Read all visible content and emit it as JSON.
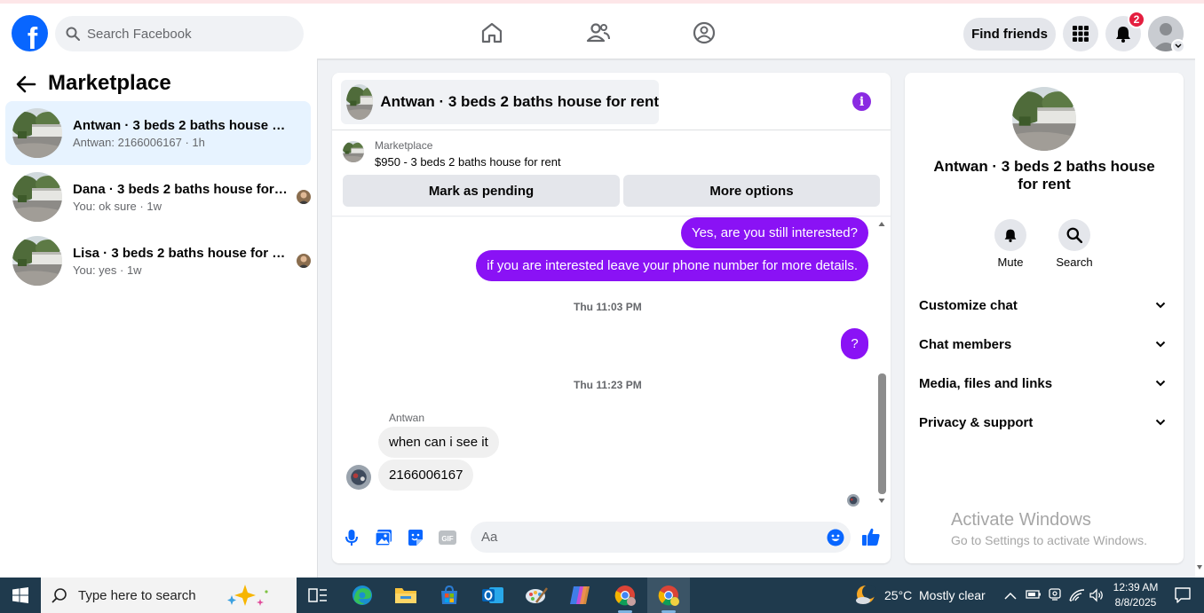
{
  "topbar": {
    "logo_letter": "f",
    "search_placeholder": "Search Facebook",
    "find_friends_label": "Find friends",
    "notification_count": "2"
  },
  "sidebar": {
    "title": "Marketplace",
    "conversations": [
      {
        "title": "Antwan · 3 beds 2 baths house for rent",
        "subtitle": "Antwan: 2166006167 · 1h",
        "active": true
      },
      {
        "title": "Dana · 3 beds 2 baths house for rent",
        "subtitle": "You: ok sure · 1w",
        "active": false
      },
      {
        "title": "Lisa · 3 beds 2 baths house for rent",
        "subtitle": "You: yes · 1w",
        "active": false
      }
    ]
  },
  "chat": {
    "header_title": "Antwan · 3 beds 2 baths house for rent",
    "listing_label": "Marketplace",
    "listing_title": "$950 - 3 beds 2 baths house for rent",
    "mark_pending_label": "Mark as pending",
    "more_options_label": "More options",
    "messages": {
      "out1": "Yes, are you still interested?",
      "out2": "if you are interested leave your phone number for more details.",
      "time1": "Thu 11:03 PM",
      "out3": "?",
      "time2": "Thu 11:23 PM",
      "sender": "Antwan",
      "in1": "when can i see it",
      "in2": "2166006167"
    },
    "composer_placeholder": "Aa"
  },
  "details": {
    "title": "Antwan · 3 beds 2 baths house for rent",
    "mute_label": "Mute",
    "search_label": "Search",
    "sections": [
      "Customize chat",
      "Chat members",
      "Media, files and links",
      "Privacy & support"
    ]
  },
  "watermark": {
    "line1": "Activate Windows",
    "line2": "Go to Settings to activate Windows."
  },
  "taskbar": {
    "search_placeholder": "Type here to search",
    "weather_temp": "25°C",
    "weather_desc": "Mostly clear",
    "time": "12:39 AM",
    "date": "8/8/2025"
  },
  "colors": {
    "brand_blue": "#0866ff",
    "message_purple": "#8a12f5",
    "active_conversation": "#e7f3ff",
    "taskbar": "#1f3a4d"
  }
}
